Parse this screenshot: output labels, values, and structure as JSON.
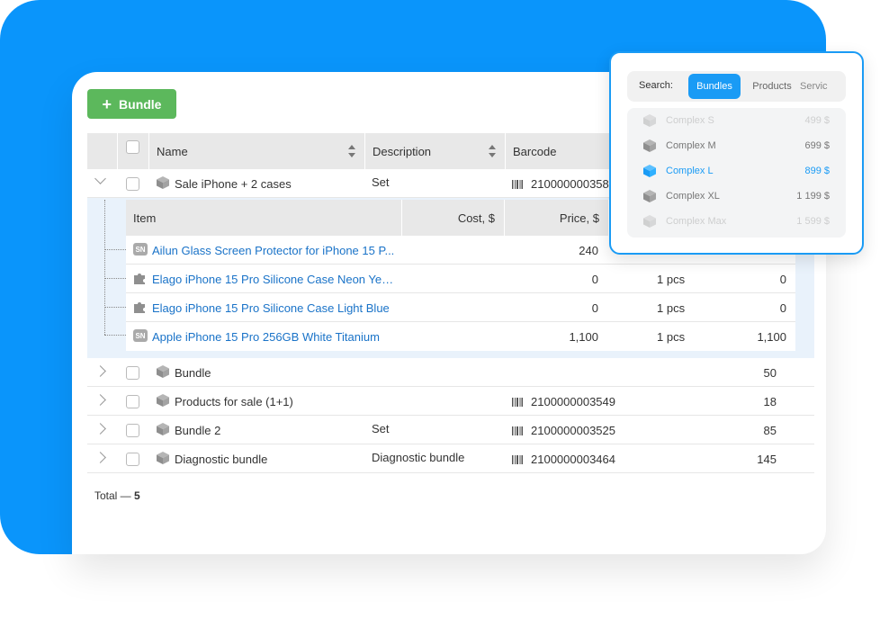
{
  "toolbar": {
    "add_label": "Bundle",
    "add_icon": "plus-icon"
  },
  "table": {
    "columns": [
      "Name",
      "Description",
      "Barcode"
    ],
    "expanded_row": {
      "name": "Sale iPhone + 2 cases",
      "description": "Set",
      "barcode": "210000000358"
    },
    "subtable": {
      "columns": [
        "Item",
        "Cost, $",
        "Price, $"
      ],
      "rows": [
        {
          "badge": "SN",
          "name": "Ailun Glass Screen Protector for iPhone 15 P...",
          "cost": "240",
          "qty": "",
          "total": ""
        },
        {
          "badge": "puzzle",
          "name": "Elago iPhone 15 Pro Silicone Case Neon Yell...",
          "cost": "0",
          "qty": "1 pcs",
          "total": "0"
        },
        {
          "badge": "puzzle",
          "name": "Elago iPhone 15 Pro Silicone Case Light Blue",
          "cost": "0",
          "qty": "1 pcs",
          "total": "0"
        },
        {
          "badge": "SN",
          "name": "Apple iPhone 15 Pro 256GB White Titanium",
          "cost": "1,100",
          "qty": "1 pcs",
          "total": "1,100"
        }
      ]
    },
    "rows": [
      {
        "name": "Bundle",
        "description": "",
        "barcode": "",
        "value": "50"
      },
      {
        "name": "Products for sale (1+1)",
        "description": "",
        "barcode": "2100000003549",
        "value": "18"
      },
      {
        "name": "Bundle 2",
        "description": "Set",
        "barcode": "2100000003525",
        "value": "85"
      },
      {
        "name": "Diagnostic bundle",
        "description": "Diagnostic bundle",
        "barcode": "2100000003464",
        "value": "145"
      }
    ],
    "total_label": "Total —",
    "total_value": "5"
  },
  "popup": {
    "search_label": "Search:",
    "tabs": [
      "Bundles",
      "Products",
      "Servic"
    ],
    "active_tab": "Bundles",
    "items": [
      {
        "name": "Complex S",
        "price": "499 $"
      },
      {
        "name": "Complex M",
        "price": "699 $"
      },
      {
        "name": "Complex L",
        "price": "899 $"
      },
      {
        "name": "Complex XL",
        "price": "1 199 $"
      },
      {
        "name": "Complex Max",
        "price": "1 599 $"
      }
    ]
  },
  "colors": {
    "accent": "#0a95fb",
    "button": "#5cb85c",
    "link": "#1a73c8",
    "selected": "#1a9bf5"
  }
}
